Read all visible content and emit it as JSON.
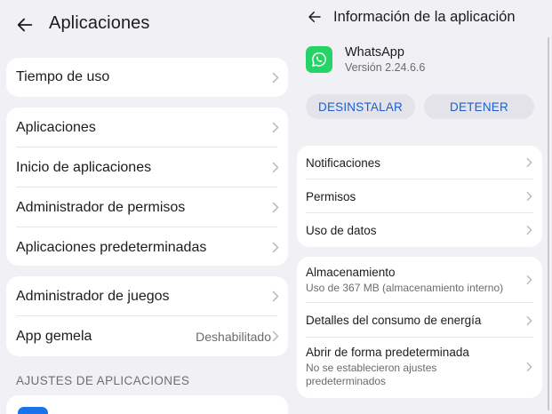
{
  "left": {
    "title": "Aplicaciones",
    "groups": [
      {
        "items": [
          {
            "label": "Tiempo de uso"
          }
        ]
      },
      {
        "items": [
          {
            "label": "Aplicaciones"
          },
          {
            "label": "Inicio de aplicaciones"
          },
          {
            "label": "Administrador de permisos"
          },
          {
            "label": "Aplicaciones predeterminadas"
          }
        ]
      },
      {
        "items": [
          {
            "label": "Administrador de juegos"
          },
          {
            "label": "App gemela",
            "value": "Deshabilitado"
          }
        ]
      }
    ],
    "section_title": "AJUSTES DE APLICACIONES"
  },
  "right": {
    "title": "Información de la aplicación",
    "app": {
      "name": "WhatsApp",
      "version": "Versión 2.24.6.6"
    },
    "buttons": {
      "uninstall": "DESINSTALAR",
      "stop": "DETENER"
    },
    "group1": [
      {
        "label": "Notificaciones"
      },
      {
        "label": "Permisos"
      },
      {
        "label": "Uso de datos"
      }
    ],
    "group2": [
      {
        "label": "Almacenamiento",
        "sub": "Uso de 367 MB (almacenamiento interno)"
      },
      {
        "label": "Detalles del consumo de energía"
      },
      {
        "label": "Abrir de forma predeterminada",
        "sub": "No se establecieron ajustes predeterminados"
      }
    ]
  },
  "colors": {
    "background": "#f1f0f5",
    "card": "#ffffff",
    "accent": "#1b5fcf",
    "whatsapp": "#25d366",
    "button_bg": "#e4e3e9"
  },
  "icons": {
    "back": "arrow-left-icon",
    "chevron": "chevron-right-icon",
    "app": "whatsapp-icon"
  }
}
